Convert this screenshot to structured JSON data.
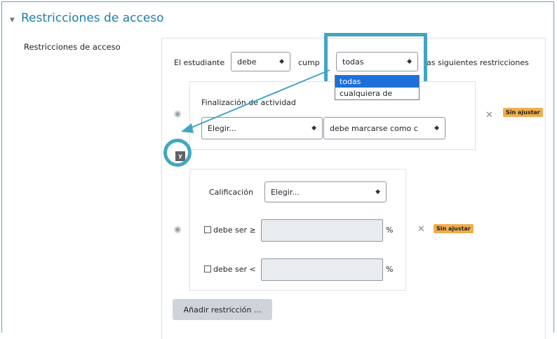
{
  "section": {
    "title": "Restricciones de acceso",
    "field_label": "Restricciones de acceso"
  },
  "sentence": {
    "prefix": "El estudiante",
    "mode_value": "debe",
    "verb": "cumplir",
    "verb_visible": "cump",
    "verb_tail": "r",
    "scope_value": "todas",
    "suffix": "las siguientes restricciones",
    "suffix_visible": "as siguientes restricciones"
  },
  "scope_dropdown": {
    "options": [
      "todas",
      "cualquiera de"
    ],
    "selected_index": 0
  },
  "condition_activity": {
    "title": "Finalización de actividad",
    "activity_select": "Elegir...",
    "state_select": "debe marcarse como c",
    "badge": "Sin ajustar"
  },
  "connector_label": "y",
  "condition_grade": {
    "label": "Calificación",
    "grade_select": "Elegir...",
    "min_label": "debe ser ≥",
    "max_label": "debe ser <",
    "percent": "%",
    "badge": "Sin ajustar"
  },
  "add_button": "Añadir restricción ...",
  "colors": {
    "accent": "#40a6c2",
    "title": "#1f7ea5",
    "badge": "#f0ad4e",
    "selected_option": "#1e6fd9"
  },
  "icons": [
    "collapse-caret-icon",
    "eye-icon",
    "close-icon",
    "select-arrow-icon"
  ]
}
